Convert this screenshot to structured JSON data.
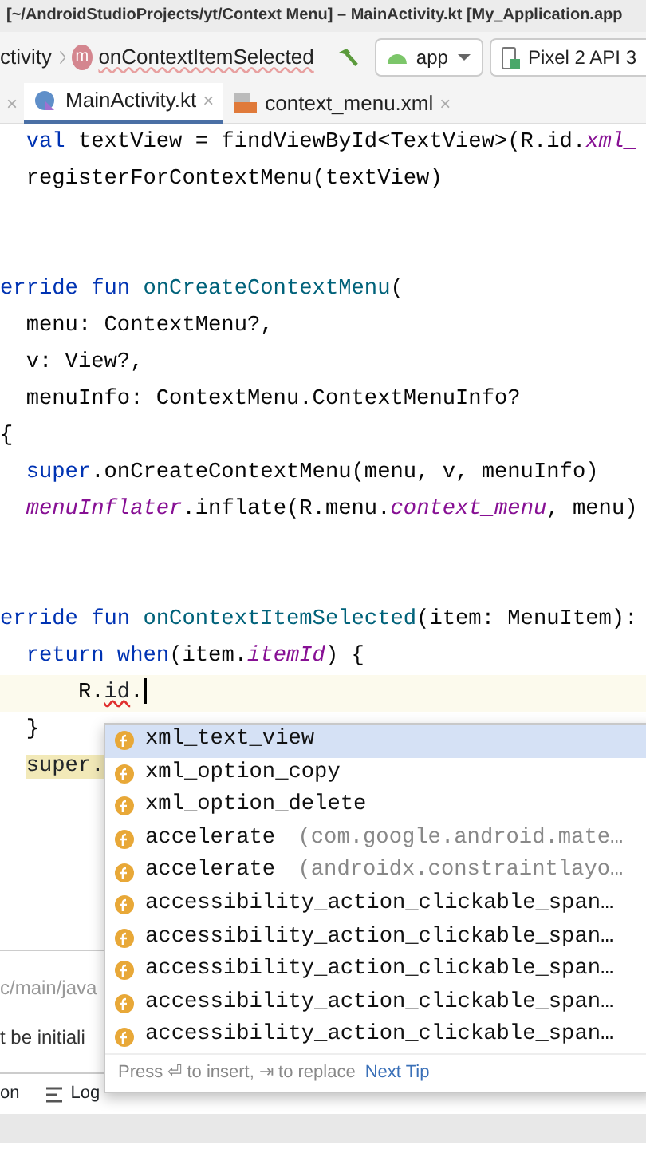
{
  "window": {
    "title": "[~/AndroidStudioProjects/yt/Context Menu] – MainActivity.kt [My_Application.app"
  },
  "breadcrumb": [
    {
      "label": "ctivity"
    },
    {
      "label": "onContextItemSelected",
      "icon_letter": "m"
    }
  ],
  "run_config": {
    "module": "app",
    "device": "Pixel 2 API 3"
  },
  "cut_tab_close": "×",
  "tabs": [
    {
      "label": "MainActivity.kt",
      "kind": "kotlin",
      "selected": true,
      "close": "×"
    },
    {
      "label": "context_menu.xml",
      "kind": "xml",
      "selected": false,
      "close": "×"
    }
  ],
  "code": {
    "lines": [
      {
        "kind": "code",
        "current": false,
        "caret": false,
        "segments": [
          {
            "text": "  val ",
            "kind": "keyword"
          },
          {
            "text": "textView = findViewById<TextView>(R.id.",
            "kind": "plain"
          },
          {
            "text": "xml_",
            "kind": "property"
          }
        ]
      },
      {
        "kind": "code",
        "current": false,
        "caret": false,
        "segments": [
          {
            "text": "  registerForContextMenu(textView)",
            "kind": "plain"
          }
        ]
      },
      {
        "kind": "blank"
      },
      {
        "kind": "blank"
      },
      {
        "kind": "code",
        "current": false,
        "caret": false,
        "segments": [
          {
            "text": "erride fun ",
            "kind": "keyword"
          },
          {
            "text": "onCreateContextMenu",
            "kind": "declaration"
          },
          {
            "text": "(",
            "kind": "plain"
          }
        ]
      },
      {
        "kind": "code",
        "current": false,
        "caret": false,
        "segments": [
          {
            "text": "  menu: ContextMenu?,",
            "kind": "plain"
          }
        ]
      },
      {
        "kind": "code",
        "current": false,
        "caret": false,
        "segments": [
          {
            "text": "  v: View?,",
            "kind": "plain"
          }
        ]
      },
      {
        "kind": "code",
        "current": false,
        "caret": false,
        "segments": [
          {
            "text": "  menuInfo: ContextMenu.ContextMenuInfo?",
            "kind": "plain"
          }
        ]
      },
      {
        "kind": "code",
        "current": false,
        "caret": false,
        "segments": [
          {
            "text": "{",
            "kind": "plain"
          }
        ]
      },
      {
        "kind": "code",
        "current": false,
        "caret": false,
        "segments": [
          {
            "text": "  super",
            "kind": "keyword"
          },
          {
            "text": ".onCreateContextMenu(menu, v, menuInfo)",
            "kind": "plain"
          }
        ]
      },
      {
        "kind": "code",
        "current": false,
        "caret": false,
        "segments": [
          {
            "text": "  menuInflater",
            "kind": "property"
          },
          {
            "text": ".inflate(R.menu.",
            "kind": "plain"
          },
          {
            "text": "context_menu",
            "kind": "property"
          },
          {
            "text": ", menu)",
            "kind": "plain"
          }
        ]
      },
      {
        "kind": "blank"
      },
      {
        "kind": "blank"
      },
      {
        "kind": "code",
        "current": false,
        "caret": false,
        "segments": [
          {
            "text": "erride fun ",
            "kind": "keyword"
          },
          {
            "text": "onContextItemSelected",
            "kind": "declaration"
          },
          {
            "text": "(item: MenuItem):",
            "kind": "plain"
          }
        ]
      },
      {
        "kind": "code",
        "current": false,
        "caret": false,
        "segments": [
          {
            "text": "  return when",
            "kind": "keyword"
          },
          {
            "text": "(item.",
            "kind": "plain"
          },
          {
            "text": "itemId",
            "kind": "property"
          },
          {
            "text": ") {",
            "kind": "plain"
          }
        ]
      },
      {
        "kind": "code",
        "current": true,
        "caret": true,
        "segments": [
          {
            "text": "      R.",
            "kind": "plain"
          },
          {
            "text": "id",
            "kind": "error"
          },
          {
            "text": ".",
            "kind": "plain"
          }
        ]
      },
      {
        "kind": "code",
        "current": false,
        "caret": false,
        "segments": [
          {
            "text": "  }",
            "kind": "plain"
          }
        ]
      },
      {
        "kind": "code",
        "current": false,
        "caret": false,
        "segments": [
          {
            "text": "super.",
            "kind": "indented_match"
          }
        ]
      }
    ]
  },
  "bottom_panel": {
    "path": "c/main/java",
    "message": "t be initiali",
    "tool_tabs": [
      {
        "label": "on",
        "icon": false
      },
      {
        "label": "Log",
        "icon": true
      }
    ]
  },
  "completion": {
    "items": [
      {
        "name": "xml_text_view",
        "selected": true
      },
      {
        "name": "xml_option_copy",
        "selected": false
      },
      {
        "name": "xml_option_delete",
        "selected": false
      },
      {
        "name": "accelerate",
        "detail": "(com.google.android.mate…",
        "selected": false
      },
      {
        "name": "accelerate",
        "detail": "(androidx.constraintlayo…",
        "selected": false
      },
      {
        "name": "accessibility_action_clickable_span…",
        "selected": false
      },
      {
        "name": "accessibility_action_clickable_span…",
        "selected": false
      },
      {
        "name": "accessibility_action_clickable_span…",
        "selected": false
      },
      {
        "name": "accessibility_action_clickable_span…",
        "selected": false
      },
      {
        "name": "accessibility_action_clickable_span…",
        "selected": false
      }
    ],
    "hint": "Press ⏎ to insert, ⇥ to replace",
    "link": "Next Tip"
  }
}
